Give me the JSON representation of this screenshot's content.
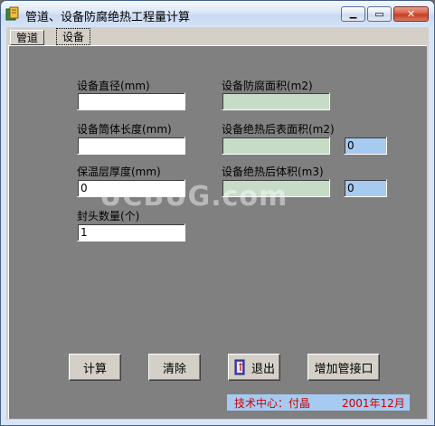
{
  "window": {
    "title": "管道、设备防腐绝热工程量计算",
    "min_glyph": "▁",
    "max_glyph": "▭",
    "close_glyph": "✕"
  },
  "tabs": [
    {
      "label": "管道"
    },
    {
      "label": "设备"
    }
  ],
  "fields": {
    "diameter_label": "设备直径(mm)",
    "diameter_value": "",
    "length_label": "设备筒体长度(mm)",
    "length_value": "",
    "insulation_label": "保温层厚度(mm)",
    "insulation_value": "0",
    "heads_label": "封头数量(个)",
    "heads_value": "1",
    "anticorr_area_label": "设备防腐面积(m2)",
    "anticorr_area_value": "",
    "surface_area_label": "设备绝热后表面积(m2)",
    "surface_area_value": "",
    "surface_area_extra": "0",
    "volume_label": "设备绝热后体积(m3)",
    "volume_value": "",
    "volume_extra": "0"
  },
  "buttons": {
    "calc": "计算",
    "clear": "清除",
    "exit": "退出",
    "add_nozzle": "增加管接口"
  },
  "footer": {
    "center": "技术中心：付晶",
    "date": "2001年12月"
  },
  "watermark": "UCBUG.com",
  "colors": {
    "panel_bg": "#808080",
    "readonly_field": "#c6dcc6",
    "highlight_field": "#a6caf0",
    "footer_text": "#cc0000"
  }
}
